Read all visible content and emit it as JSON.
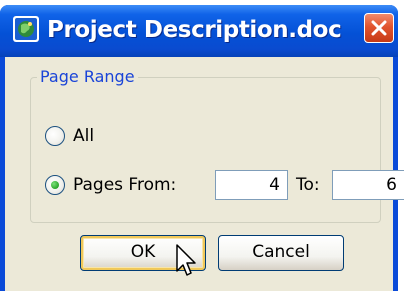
{
  "window": {
    "title": "Project Description.doc",
    "app_icon": "globe-app-icon",
    "close_icon": "close-icon"
  },
  "page_range": {
    "group_label": "Page Range",
    "option_all": {
      "label": "All",
      "selected": false
    },
    "option_pages": {
      "label": "Pages",
      "selected": true
    },
    "from_label": "From:",
    "from_value": "4",
    "to_label": "To:",
    "to_value": "6"
  },
  "buttons": {
    "ok": "OK",
    "cancel": "Cancel"
  },
  "colors": {
    "titlebar": "#0a4ad8",
    "dialog_bg": "#ece9d8",
    "group_label": "#1a44d8",
    "close_button": "#e2542e"
  }
}
